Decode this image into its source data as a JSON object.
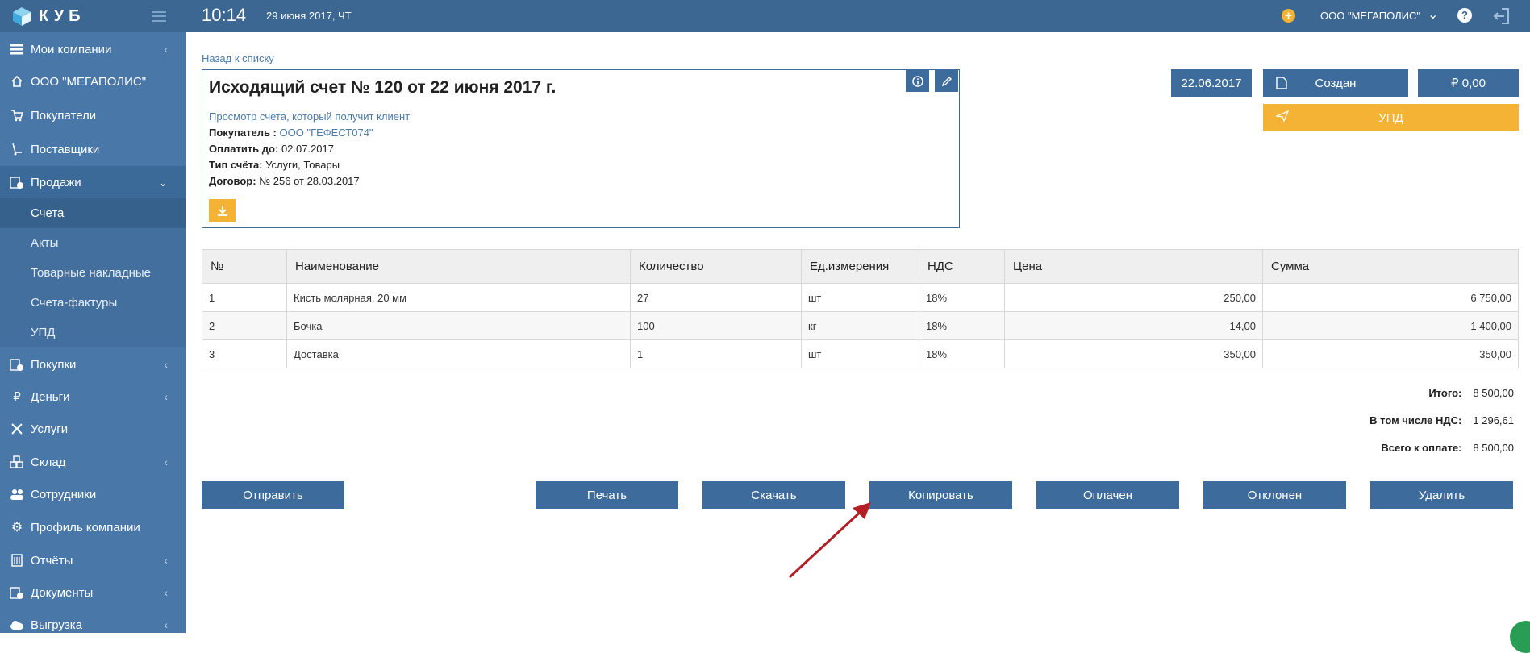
{
  "app": {
    "logo_text": "КУБ"
  },
  "topbar": {
    "time": "10:14",
    "date": "29 июня 2017, ЧТ",
    "company": "ООО \"МЕГАПОЛИС\"",
    "help": "?"
  },
  "sidebar": {
    "items": [
      {
        "label": "Мои компании",
        "icon": "list-icon"
      },
      {
        "label": "ООО \"МЕГАПОЛИС\"",
        "icon": "home-icon"
      },
      {
        "label": "Покупатели",
        "icon": "cart-icon"
      },
      {
        "label": "Поставщики",
        "icon": "hand-truck-icon"
      },
      {
        "label": "Продажи",
        "icon": "sales-icon"
      },
      {
        "label": "Покупки",
        "icon": "purchases-icon"
      },
      {
        "label": "Деньги",
        "icon": "ruble-icon"
      },
      {
        "label": "Услуги",
        "icon": "wrench-icon"
      },
      {
        "label": "Склад",
        "icon": "boxes-icon"
      },
      {
        "label": "Сотрудники",
        "icon": "users-icon"
      },
      {
        "label": "Профиль компании",
        "icon": "gear-icon"
      },
      {
        "label": "Отчёты",
        "icon": "building-icon"
      },
      {
        "label": "Документы",
        "icon": "documents-icon"
      },
      {
        "label": "Выгрузка",
        "icon": "cloud-upload-icon"
      }
    ],
    "sales_sub": [
      "Счета",
      "Акты",
      "Товарные накладные",
      "Счета-фактуры",
      "УПД"
    ]
  },
  "main": {
    "back_link": "Назад к списку",
    "invoice": {
      "title": "Исходящий счет № 120 от 22 июня 2017 г.",
      "preview_link": "Просмотр счета, который получит клиент",
      "buyer_label": "Покупатель :",
      "buyer_value": "ООО \"ГЕФЕСТ074\"",
      "pay_until_label": "Оплатить до:",
      "pay_until_value": "02.07.2017",
      "type_label": "Тип счёта:",
      "type_value": "Услуги, Товары",
      "contract_label": "Договор:",
      "contract_value": "№ 256 от 28.03.2017"
    },
    "status": {
      "date": "22.06.2017",
      "state": "Создан",
      "amount": "₽ 0,00",
      "upd": "УПД"
    },
    "table": {
      "headers": [
        "№",
        "Наименование",
        "Количество",
        "Ед.измерения",
        "НДС",
        "Цена",
        "Сумма"
      ],
      "rows": [
        [
          "1",
          "Кисть молярная, 20 мм",
          "27",
          "шт",
          "18%",
          "250,00",
          "6 750,00"
        ],
        [
          "2",
          "Бочка",
          "100",
          "кг",
          "18%",
          "14,00",
          "1 400,00"
        ],
        [
          "3",
          "Доставка",
          "1",
          "шт",
          "18%",
          "350,00",
          "350,00"
        ]
      ]
    },
    "totals": {
      "total_label": "Итого:",
      "total_value": "8 500,00",
      "vat_label": "В том числе НДС:",
      "vat_value": "1 296,61",
      "due_label": "Всего к оплате:",
      "due_value": "8 500,00"
    },
    "actions": {
      "send": "Отправить",
      "print": "Печать",
      "download": "Скачать",
      "copy": "Копировать",
      "paid": "Оплачен",
      "rejected": "Отклонен",
      "delete": "Удалить"
    }
  },
  "colors": {
    "sidebar": "#4877a8",
    "topbar": "#3b6792",
    "button": "#3d6c9c",
    "accent": "#f5b335",
    "arrow": "#b21e24"
  }
}
